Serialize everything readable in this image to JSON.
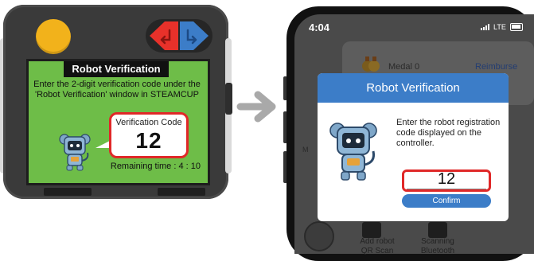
{
  "controller": {
    "screen_title": "Robot Verification",
    "message": "Enter the 2-digit verification code under the 'Robot Verification' window in STEAMCUP",
    "code_label": "Verification Code",
    "code_value": "12",
    "remaining_time": "Remaining time : 4 : 10",
    "button_colors": {
      "yellow": "#f2b21b",
      "red": "#e8312a",
      "blue": "#3c7dc8"
    }
  },
  "phone": {
    "status": {
      "time": "4:04",
      "network": "LTE"
    },
    "background": {
      "medal_label": "Medal 0",
      "reimburse_label": "Reimburse",
      "bottom_items": [
        {
          "line1": "Add robot",
          "line2": "QR Scan"
        },
        {
          "line1": "Scanning",
          "line2": "Bluetooth"
        }
      ],
      "partial_left_text": "M"
    },
    "dialog": {
      "title": "Robot Verification",
      "message": "Enter the robot registration code displayed on the controller.",
      "code_value": "12",
      "confirm_label": "Confirm"
    }
  }
}
